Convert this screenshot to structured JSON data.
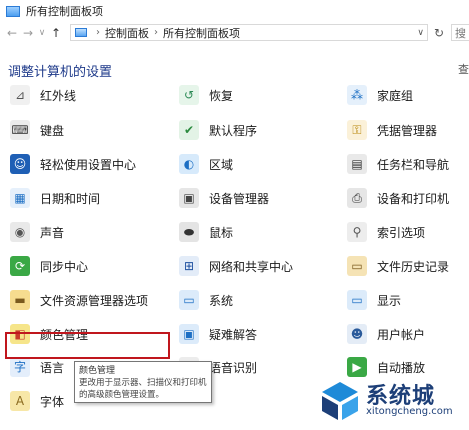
{
  "window": {
    "title": "所有控制面板项"
  },
  "nav": {
    "back_icon": "←",
    "forward_icon": "→",
    "dropdown_icon": "∨",
    "up_icon": "↑",
    "breadcrumb": [
      "控制面板",
      "所有控制面板项"
    ],
    "separator": "›",
    "address_dropdown_icon": "∨",
    "refresh_icon": "↻",
    "search_stub": "搜"
  },
  "heading": "调整计算机的设置",
  "view_by_stub": "查",
  "items": [
    {
      "label": "红外线",
      "icon": "infrared-icon",
      "glyph": "⊿"
    },
    {
      "label": "恢复",
      "icon": "recovery-icon",
      "glyph": "↺"
    },
    {
      "label": "家庭组",
      "icon": "homegroup-icon",
      "glyph": "⁂"
    },
    {
      "label": "键盘",
      "icon": "keyboard-icon",
      "glyph": "⌨"
    },
    {
      "label": "默认程序",
      "icon": "default-programs-icon",
      "glyph": "✔"
    },
    {
      "label": "凭据管理器",
      "icon": "credential-manager-icon",
      "glyph": "⚿"
    },
    {
      "label": "轻松使用设置中心",
      "icon": "ease-of-access-icon",
      "glyph": "☺"
    },
    {
      "label": "区域",
      "icon": "region-icon",
      "glyph": "◐"
    },
    {
      "label": "任务栏和导航",
      "icon": "taskbar-icon",
      "glyph": "▤"
    },
    {
      "label": "日期和时间",
      "icon": "date-time-icon",
      "glyph": "▦"
    },
    {
      "label": "设备管理器",
      "icon": "device-manager-icon",
      "glyph": "▣"
    },
    {
      "label": "设备和打印机",
      "icon": "devices-printers-icon",
      "glyph": "⎙"
    },
    {
      "label": "声音",
      "icon": "sound-icon",
      "glyph": "◉"
    },
    {
      "label": "鼠标",
      "icon": "mouse-icon",
      "glyph": "⬬"
    },
    {
      "label": "索引选项",
      "icon": "indexing-options-icon",
      "glyph": "⚲"
    },
    {
      "label": "同步中心",
      "icon": "sync-center-icon",
      "glyph": "⟳"
    },
    {
      "label": "网络和共享中心",
      "icon": "network-sharing-icon",
      "glyph": "⊞"
    },
    {
      "label": "文件历史记录",
      "icon": "file-history-icon",
      "glyph": "▭"
    },
    {
      "label": "文件资源管理器选项",
      "icon": "file-explorer-options-icon",
      "glyph": "▬"
    },
    {
      "label": "系统",
      "icon": "system-icon",
      "glyph": "▭"
    },
    {
      "label": "显示",
      "icon": "display-icon",
      "glyph": "▭"
    },
    {
      "label": "颜色管理",
      "icon": "color-management-icon",
      "glyph": "◧"
    },
    {
      "label": "疑难解答",
      "icon": "troubleshooting-icon",
      "glyph": "▣"
    },
    {
      "label": "用户帐户",
      "icon": "user-accounts-icon",
      "glyph": "☻"
    },
    {
      "label": "语言",
      "icon": "language-icon",
      "glyph": "字"
    },
    {
      "label": "语音识别",
      "icon": "speech-recognition-icon",
      "glyph": "◎"
    },
    {
      "label": "自动播放",
      "icon": "autoplay-icon",
      "glyph": "▶"
    },
    {
      "label": "字体",
      "icon": "fonts-icon",
      "glyph": "A"
    }
  ],
  "tooltip": {
    "title": "颜色管理",
    "description": "更改用于显示器、扫描仪和打印机的高级颜色管理设置。"
  },
  "watermark": {
    "brand": "系统城",
    "url": "xitongcheng.com"
  },
  "colors": {
    "heading": "#1e3a8a",
    "highlight_border": "#c0161d",
    "watermark": "#1d3f78",
    "watermark_accent": "#1e8ad8"
  }
}
